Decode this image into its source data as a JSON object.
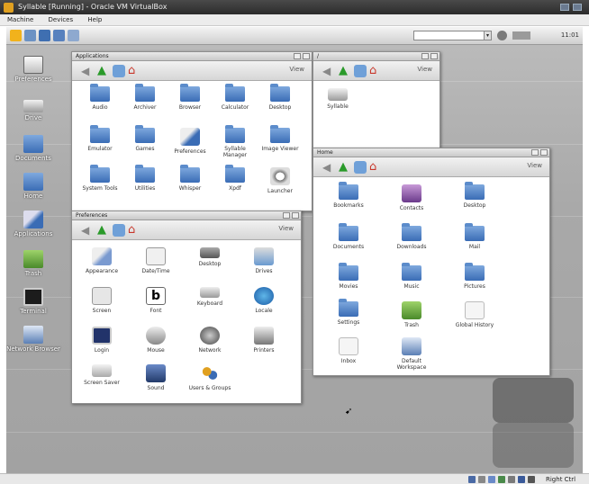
{
  "vbox": {
    "title": "Syllable [Running] - Oracle VM VirtualBox",
    "menu": [
      "Machine",
      "Devices",
      "Help"
    ],
    "host_key": "Right Ctrl"
  },
  "guest": {
    "clock": "11:01",
    "desktop_icons": [
      {
        "label": "Preferences",
        "icon": "preferences-icon"
      },
      {
        "label": "Drive",
        "icon": "drive-icon"
      },
      {
        "label": "Documents",
        "icon": "documents-icon"
      },
      {
        "label": "Home",
        "icon": "home-icon"
      },
      {
        "label": "Applications",
        "icon": "applications-icon"
      },
      {
        "label": "Trash",
        "icon": "trash-icon"
      },
      {
        "label": "Terminal",
        "icon": "terminal-icon"
      },
      {
        "label": "Network Browser",
        "icon": "network-icon"
      }
    ],
    "windows": {
      "applications": {
        "title": "Applications",
        "view_label": "View",
        "items": [
          "Audio",
          "Archiver",
          "Browser",
          "Calculator",
          "Desktop",
          "Emulator",
          "Games",
          "Preferences",
          "Syllable Manager",
          "Image Viewer",
          "System Tools",
          "Utilities",
          "Whisper",
          "Xpdf",
          "Launcher"
        ]
      },
      "drive": {
        "title": "/",
        "view_label": "View",
        "items": [
          "Syllable"
        ]
      },
      "preferences": {
        "title": "Preferences",
        "view_label": "View",
        "items": [
          "Appearance",
          "Date/Time",
          "Desktop",
          "Drives",
          "Screen",
          "Font",
          "Keyboard",
          "Locale",
          "Login",
          "Mouse",
          "Network",
          "Printers",
          "Screen Saver",
          "Sound",
          "Users & Groups"
        ]
      },
      "home": {
        "title": "Home",
        "view_label": "View",
        "items": [
          "Bookmarks",
          "Contacts",
          "Desktop",
          "Documents",
          "Downloads",
          "Mail",
          "Movies",
          "Music",
          "Pictures",
          "Settings",
          "Trash",
          "Global History",
          "Inbox",
          "Default Workspace"
        ]
      }
    }
  }
}
